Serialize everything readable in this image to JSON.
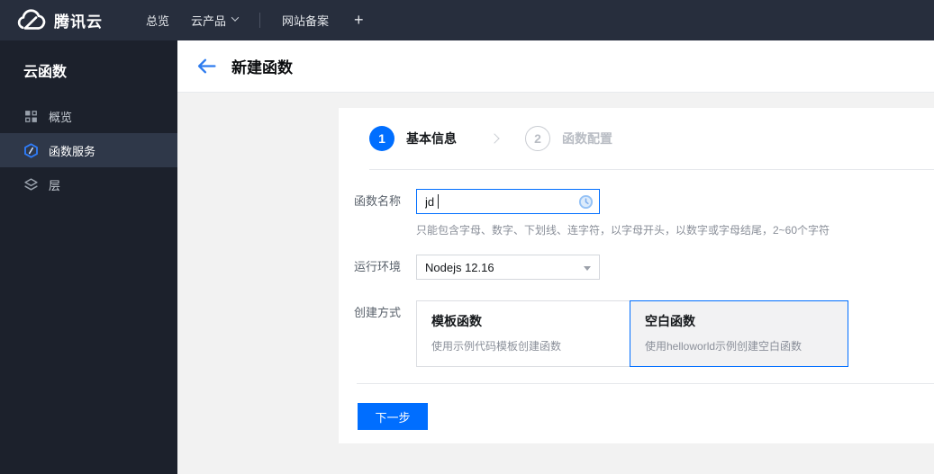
{
  "colors": {
    "accent": "#006eff",
    "topbar_bg": "#272e3d",
    "sidebar_bg": "#1c212c",
    "sidebar_active_bg": "#2f3849",
    "content_bg": "#f2f2f2",
    "selected_card_bg": "#f2f2f3",
    "divider": "#e6e8ec",
    "inactive_step": "#b9bdc4"
  },
  "icons": {
    "logo": "tencent-cloud",
    "nav_products_caret": "chevron-down",
    "sidebar_overview": "grid",
    "sidebar_scf": "hexagon-slash",
    "sidebar_layers": "layers",
    "back": "arrow-left",
    "step_separator": "chevron-right",
    "name_status": "clock",
    "select_arrow": "triangle-down"
  },
  "topbar": {
    "logo_text": "腾讯云",
    "nav_overview": "总览",
    "nav_products": "云产品",
    "nav_beian": "网站备案",
    "nav_add": "+"
  },
  "sidebar": {
    "title": "云函数",
    "items": [
      {
        "label": "概览",
        "active": false
      },
      {
        "label": "函数服务",
        "active": true
      },
      {
        "label": "层",
        "active": false
      }
    ]
  },
  "header": {
    "title": "新建函数"
  },
  "wizard": {
    "step1_num": "1",
    "step1_label": "基本信息",
    "step2_num": "2",
    "step2_label": "函数配置"
  },
  "form": {
    "name_label": "函数名称",
    "name_value": "jd",
    "name_help": "只能包含字母、数字、下划线、连字符，以字母开头，以数字或字母结尾，2~60个字符",
    "runtime_label": "运行环境",
    "runtime_value": "Nodejs 12.16",
    "method_label": "创建方式",
    "method_options": [
      {
        "title": "模板函数",
        "desc": "使用示例代码模板创建函数",
        "selected": false
      },
      {
        "title": "空白函数",
        "desc": "使用helloworld示例创建空白函数",
        "selected": true
      }
    ]
  },
  "footer": {
    "next": "下一步"
  }
}
